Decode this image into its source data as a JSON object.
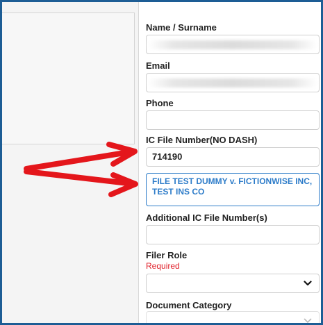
{
  "form": {
    "name_label": "Name / Surname",
    "name_value": "",
    "email_label": "Email",
    "email_value": "",
    "phone_label": "Phone",
    "phone_value": "",
    "ic_label": "IC File Number(NO DASH)",
    "ic_value": "714190",
    "match_result": "FILE TEST DUMMY v. FICTIONWISE INC, TEST INS CO",
    "additional_label": "Additional IC File Number(s)",
    "additional_value": "",
    "filer_role_label": "Filer Role",
    "filer_role_required": "Required",
    "filer_role_value": "",
    "doc_category_label": "Document Category",
    "doc_category_value": ""
  },
  "icons": {
    "dropdown": "chevron-down-icon",
    "annotation": "red-arrow"
  },
  "colors": {
    "frame_border": "#1d5d95",
    "result_text": "#2d7cc9",
    "required_text": "#e0202a",
    "annotation_arrow": "#e4161b"
  }
}
